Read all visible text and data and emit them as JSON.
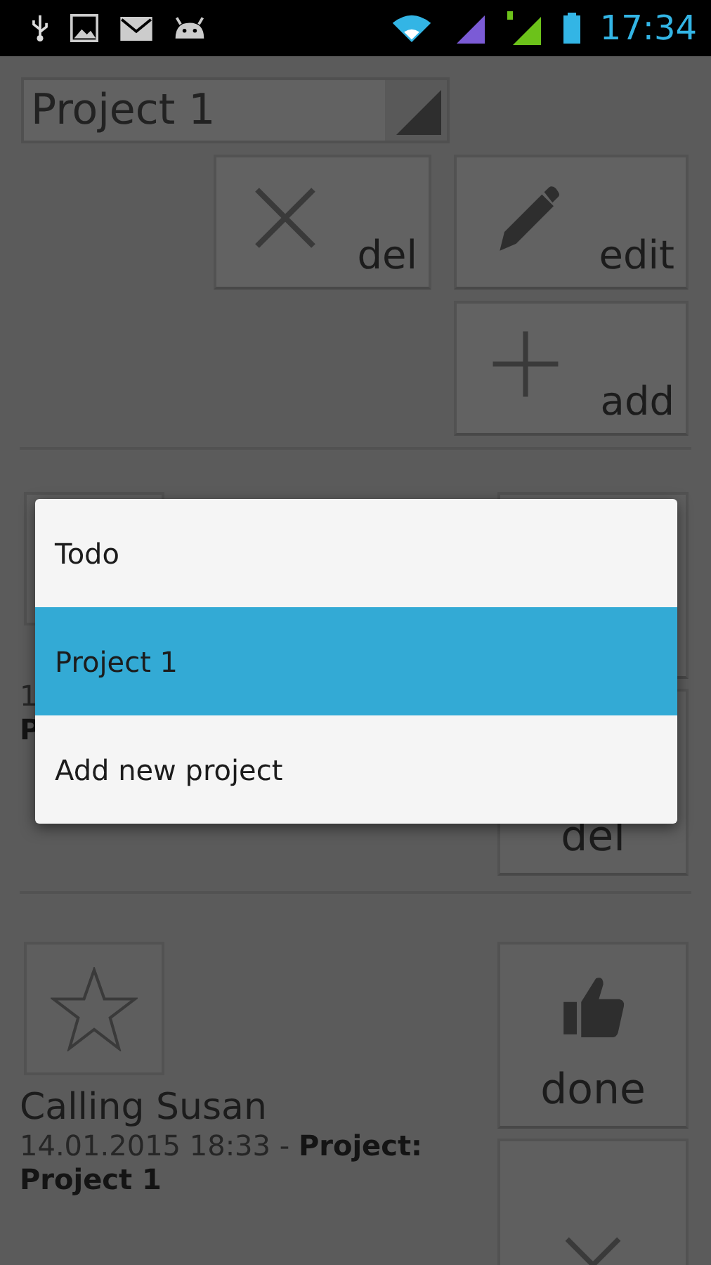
{
  "status_bar": {
    "time": "17:34"
  },
  "spinner": {
    "value": "Project 1"
  },
  "actions": [
    {
      "kind": "cross",
      "label": "del"
    },
    {
      "kind": "pencil",
      "label": "edit"
    },
    {
      "kind": "plus",
      "label": "add"
    }
  ],
  "tasks": [
    {
      "star_button": {
        "kind": "blank"
      },
      "lines": [
        "1",
        "**P**"
      ],
      "buttons": [
        {
          "kind": "blank"
        },
        {
          "kind": "blank",
          "label": "del"
        }
      ]
    },
    {
      "star_button": {
        "kind": "star"
      },
      "title": "Calling Susan",
      "lines": [
        "14.01.2015 18:33 - **Project:**",
        "**Project 1**"
      ],
      "buttons": [
        {
          "kind": "thumb",
          "label": "done"
        },
        {
          "kind": "cross"
        }
      ]
    }
  ],
  "popup": {
    "items": [
      {
        "label": "Todo",
        "selected": false
      },
      {
        "label": "Project 1",
        "selected": true
      },
      {
        "label": "Add new project",
        "selected": false
      }
    ]
  }
}
